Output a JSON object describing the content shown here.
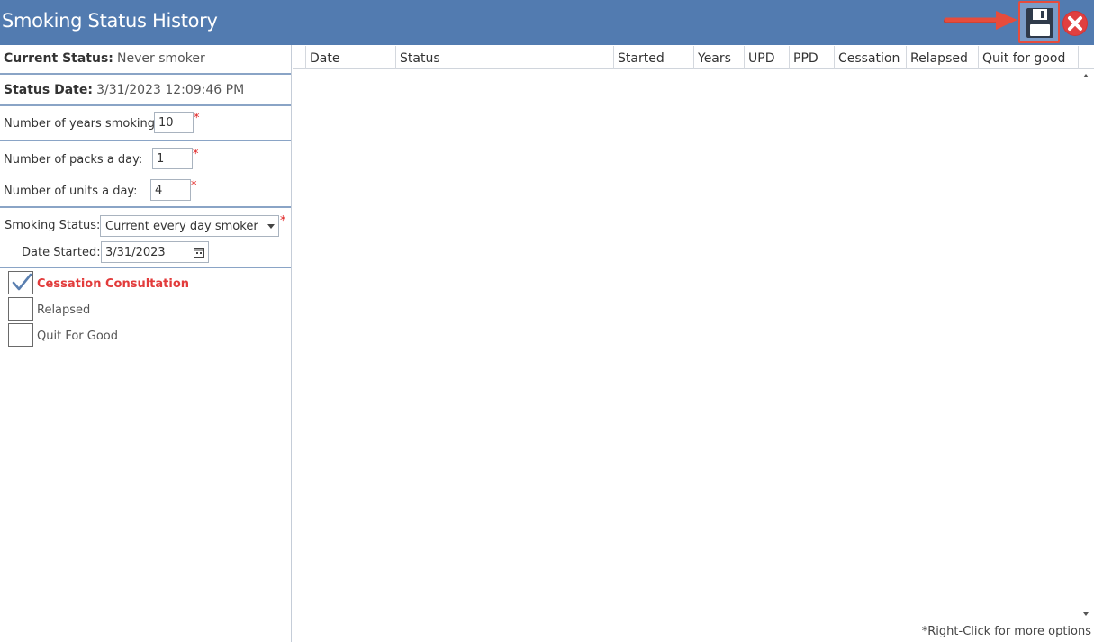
{
  "window": {
    "title": "Smoking Status History"
  },
  "toolbar": {
    "save_icon": "floppy-disk-icon",
    "close_icon": "close-icon",
    "arrow_color": "#e74c3c"
  },
  "colors": {
    "titlebar": "#527bb0",
    "required": "#e02020",
    "highlight": "#e23b3b"
  },
  "summary": {
    "current_status_label": "Current Status:",
    "current_status_value": "Never smoker",
    "status_date_label": "Status Date:",
    "status_date_value": "3/31/2023 12:09:46 PM"
  },
  "form": {
    "years_label": "Number of years smoking:",
    "years_value": "10",
    "packs_label": "Number of packs a day:",
    "packs_value": "1",
    "units_label": "Number of units a day:",
    "units_value": "4",
    "required_mark": "*",
    "status_label": "Smoking Status:",
    "status_value": "Current every day smoker",
    "date_started_label": "Date Started:",
    "date_started_value": "3/31/2023"
  },
  "checkboxes": [
    {
      "label": "Cessation Consultation",
      "checked": true
    },
    {
      "label": "Relapsed",
      "checked": false
    },
    {
      "label": "Quit For Good",
      "checked": false
    }
  ],
  "grid": {
    "columns": [
      "Date",
      "Status",
      "Started",
      "Years",
      "UPD",
      "PPD",
      "Cessation",
      "Relapsed",
      "Quit for good"
    ],
    "rows": [],
    "footer_note": "*Right-Click for more options"
  }
}
